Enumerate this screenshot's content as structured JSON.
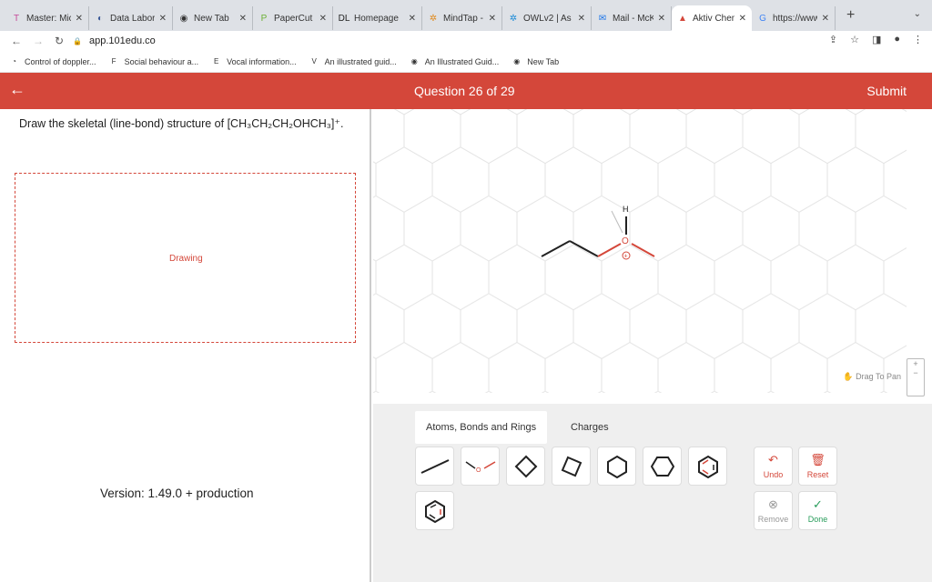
{
  "browser": {
    "tabs": [
      {
        "title": "Master: Mic",
        "icon": "T",
        "color": "#c54a9a"
      },
      {
        "title": "Data Labor",
        "icon": "◐",
        "color": "#3b5998"
      },
      {
        "title": "New Tab",
        "icon": "◉",
        "color": "#333"
      },
      {
        "title": "PaperCut M",
        "icon": "P",
        "color": "#6bb035"
      },
      {
        "title": "Homepage",
        "icon": "DL",
        "color": "#222"
      },
      {
        "title": "MindTap - C",
        "icon": "✲",
        "color": "#e08a1e"
      },
      {
        "title": "OWLv2 | As",
        "icon": "✲",
        "color": "#1a8ad6"
      },
      {
        "title": "Mail - McKi",
        "icon": "✉",
        "color": "#1a73e8"
      },
      {
        "title": "Aktiv Chem",
        "icon": "▲",
        "color": "#d4473a"
      },
      {
        "title": "https://www",
        "icon": "G",
        "color": "#4285f4"
      }
    ],
    "active_tab": 8,
    "url": "app.101edu.co",
    "bookmarks": [
      {
        "label": "Control of doppler...",
        "icon": "◔"
      },
      {
        "label": "Social behaviour a...",
        "icon": "F"
      },
      {
        "label": "Vocal information...",
        "icon": "E"
      },
      {
        "label": "An illustrated guid...",
        "icon": "V"
      },
      {
        "label": "An Illustrated Guid...",
        "icon": "◉"
      },
      {
        "label": "New Tab",
        "icon": "◉"
      }
    ]
  },
  "header": {
    "question": "Question 26 of 29",
    "submit": "Submit",
    "color": "#d4473a"
  },
  "question": {
    "prompt": "Draw the skeletal (line-bond) structure of [CH₃CH₂CH₂OHCH₃]⁺.",
    "drawing_label": "Drawing",
    "version": "Version: 1.49.0 + production"
  },
  "canvas": {
    "atoms": {
      "hydrogen": "H",
      "oxygen": "O",
      "charge": "+"
    },
    "pan_label": "Drag To Pan",
    "zoom_in": "+"
  },
  "toolbar": {
    "tabs": [
      "Atoms, Bonds and Rings",
      "Charges"
    ],
    "undo": "Undo",
    "reset": "Reset",
    "remove": "Remove",
    "done": "Done",
    "undo_color": "#d4473a",
    "done_color": "#2a9d5c"
  }
}
